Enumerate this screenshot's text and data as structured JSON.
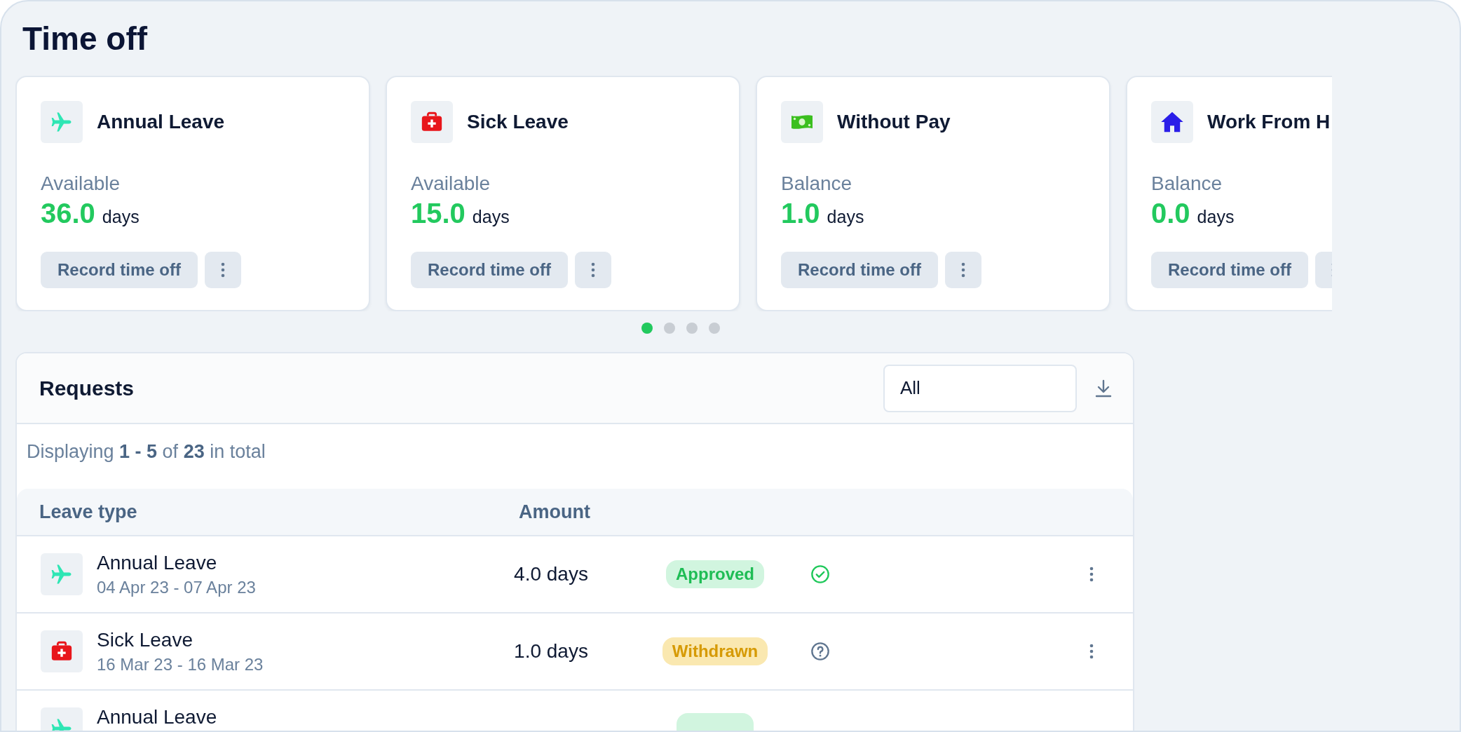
{
  "page": {
    "title": "Time off"
  },
  "cards": [
    {
      "kind": "annual",
      "title": "Annual Leave",
      "label": "Available",
      "amount": "36.0",
      "unit": "days",
      "button": "Record time off"
    },
    {
      "kind": "sick",
      "title": "Sick Leave",
      "label": "Available",
      "amount": "15.0",
      "unit": "days",
      "button": "Record time off"
    },
    {
      "kind": "unpaid",
      "title": "Without Pay",
      "label": "Balance",
      "amount": "1.0",
      "unit": "days",
      "button": "Record time off"
    },
    {
      "kind": "home",
      "title": "Work From H",
      "label": "Balance",
      "amount": "0.0",
      "unit": "days",
      "button": "Record time off"
    }
  ],
  "pager": [
    {
      "selected": true
    },
    {
      "selected": false
    },
    {
      "selected": false
    },
    {
      "selected": false
    }
  ],
  "requests": {
    "title": "Requests",
    "filter": {
      "value": "All"
    },
    "summary": "Displaying **1 - 5** of **23** in total",
    "columns": [
      "Leave type",
      "Amount"
    ],
    "rows": [
      {
        "kind": "annual",
        "name": "Annual Leave",
        "dates": "04 Apr 23 - 07 Apr 23",
        "amount": "4.0 days",
        "badge": {
          "kind": "approved",
          "label": "Approved"
        }
      },
      {
        "kind": "sick",
        "name": "Sick Leave",
        "dates": "16 Mar 23 - 16 Mar 23",
        "amount": "1.0 days",
        "badge": {
          "kind": "withdrawn",
          "label": "Withdrawn"
        }
      },
      {
        "kind": "annual",
        "name": "Annual Leave",
        "badge": {
          "kind": "approved"
        }
      }
    ]
  }
}
